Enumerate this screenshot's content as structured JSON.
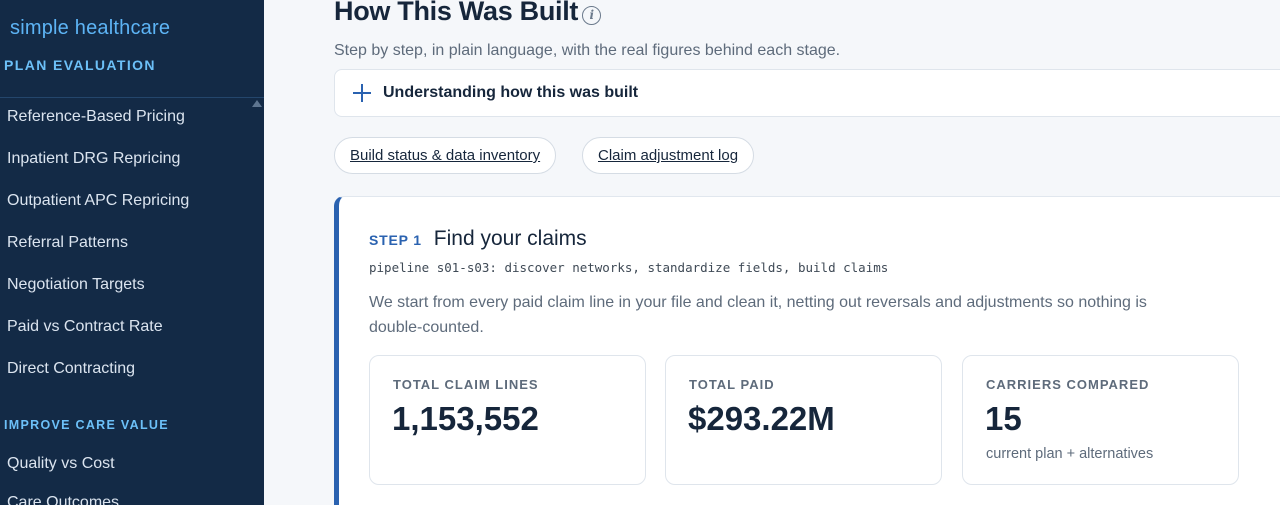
{
  "sidebar": {
    "brand": "simple healthcare",
    "section1": "PLAN EVALUATION",
    "items1": [
      "Reference-Based Pricing",
      "Inpatient DRG Repricing",
      "Outpatient APC Repricing",
      "Referral Patterns",
      "Negotiation Targets",
      "Paid vs Contract Rate",
      "Direct Contracting"
    ],
    "section2": "IMPROVE CARE VALUE",
    "items2": [
      "Quality vs Cost",
      "Care Outcomes"
    ]
  },
  "main": {
    "title": "How This Was Built",
    "subtitle": "Step by step, in plain language, with the real figures behind each stage.",
    "accordion_label": "Understanding how this was built",
    "pills": [
      "Build status & data inventory",
      "Claim adjustment log"
    ],
    "step": {
      "number": "STEP 1",
      "title": "Find your claims",
      "pipeline": "pipeline s01-s03: discover networks, standardize fields, build claims",
      "description": "We start from every paid claim line in your file and clean it, netting out reversals and adjustments so nothing is double-counted.",
      "stats": [
        {
          "label": "TOTAL CLAIM LINES",
          "value": "1,153,552",
          "note": ""
        },
        {
          "label": "TOTAL PAID",
          "value": "$293.22M",
          "note": ""
        },
        {
          "label": "CARRIERS COMPARED",
          "value": "15",
          "note": "current plan + alternatives"
        }
      ]
    }
  },
  "colors": {
    "sidebar_bg": "#132a46",
    "accent": "#2a62b0",
    "brand": "#5db4f5"
  }
}
